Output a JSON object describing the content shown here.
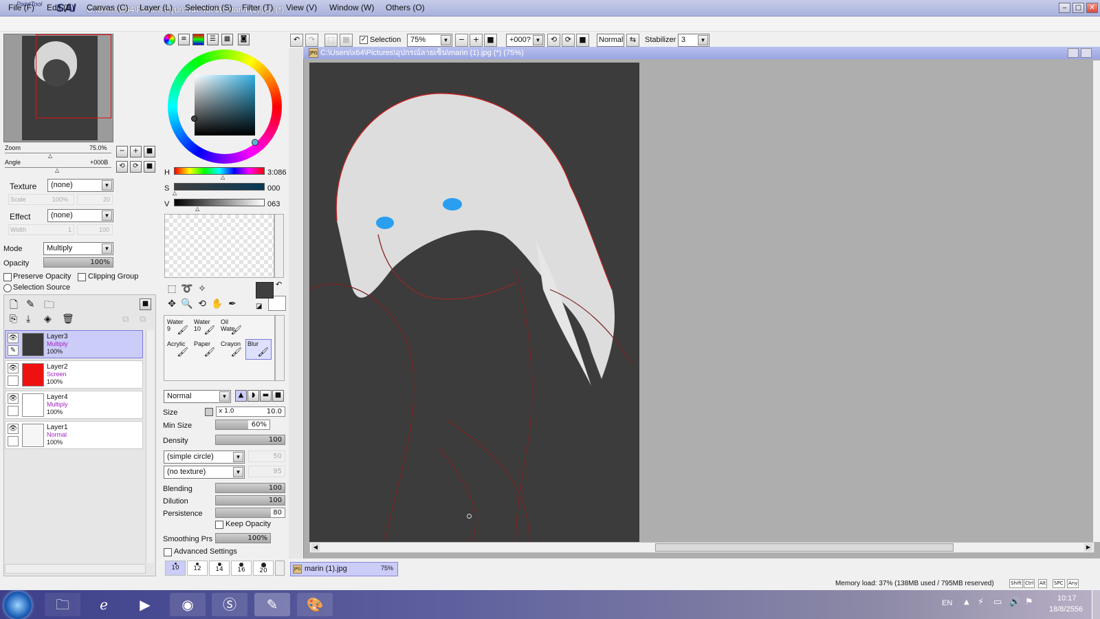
{
  "app": {
    "logo_small": "PaintTool",
    "logo_big": "SAI",
    "title": "C:\\Users\\x64\\Pictures\\อุปกรณ์ลายเซ็น\\marin (1).jpg (*)"
  },
  "menu": [
    "File (F)",
    "Edit (E)",
    "Canvas (C)",
    "Layer (L)",
    "Selection (S)",
    "Filter (T)",
    "View (V)",
    "Window (W)",
    "Others (O)"
  ],
  "toolbar": {
    "selection_label": "Selection",
    "selection_checked": true,
    "zoom": "75%",
    "angle": "+000?",
    "mode": "Normal",
    "stabilizer_label": "Stabilizer",
    "stabilizer": "3"
  },
  "navigator": {
    "zoom_label": "Zoom",
    "zoom_value": "75.0%",
    "angle_label": "Angle",
    "angle_value": "+000B"
  },
  "layer_props": {
    "texture_label": "Texture",
    "texture_value": "(none)",
    "scale_label": "Scale",
    "scale_value": "100%",
    "scale_num": "20",
    "effect_label": "Effect",
    "effect_value": "(none)",
    "width_label": "Width",
    "width_value": "1",
    "width_num": "100",
    "mode_label": "Mode",
    "mode_value": "Multiply",
    "opacity_label": "Opacity",
    "opacity_value": "100%",
    "preserve_opacity": "Preserve Opacity",
    "clipping_group": "Clipping Group",
    "selection_source": "Selection Source"
  },
  "layers": [
    {
      "name": "Layer3",
      "mode": "Multiply",
      "opacity": "100%",
      "selected": true,
      "thumb": "#3a3a3a"
    },
    {
      "name": "Layer2",
      "mode": "Screen",
      "opacity": "100%",
      "selected": false,
      "thumb": "#ee1111"
    },
    {
      "name": "Layer4",
      "mode": "Multiply",
      "opacity": "100%",
      "selected": false,
      "thumb": "#ffffff"
    },
    {
      "name": "Layer1",
      "mode": "Normal",
      "opacity": "100%",
      "selected": false,
      "thumb": "#f6f6f6"
    }
  ],
  "color": {
    "h_label": "H",
    "h_value": "3:086",
    "s_label": "S",
    "s_value": "000",
    "v_label": "V",
    "v_value": "063",
    "foreground": "#3f3f3f",
    "background": "#ffffff"
  },
  "brushes": [
    {
      "size": "9",
      "name": "Water"
    },
    {
      "size": "10",
      "name": "Water"
    },
    {
      "size": "",
      "name": "Oil Wate"
    },
    {
      "size": "",
      "name": ""
    },
    {
      "size": "",
      "name": "Acrylic"
    },
    {
      "size": "",
      "name": "Paper"
    },
    {
      "size": "",
      "name": "Crayon"
    },
    {
      "size": "",
      "name": "Blur"
    }
  ],
  "brush_settings": {
    "blend_mode": "Normal",
    "size_label": "Size",
    "size_mult": "x 1.0",
    "size_value": "10.0",
    "min_size_label": "Min Size",
    "min_size_value": "60%",
    "min_size_level": 0.6,
    "density_label": "Density",
    "density_value": "100",
    "shape": "(simple circle)",
    "shape_value": "50",
    "texture": "(no texture)",
    "texture_value": "95",
    "blending_label": "Blending",
    "blending_value": "100",
    "dilution_label": "Dilution",
    "dilution_value": "100",
    "persistence_label": "Persistence",
    "persistence_value": "80",
    "keep_opacity": "Keep Opacity",
    "smoothing_label": "Smoothing Prs",
    "smoothing_value": "100%",
    "advanced": "Advanced Settings",
    "preset_sizes": [
      "10",
      "12",
      "14",
      "16",
      "20"
    ]
  },
  "document": {
    "title": "C:\\Users\\x64\\Pictures\\อุปกรณ์ลายเซ็น\\marin (1).jpg (*) (75%)",
    "tab_name": "marin (1).jpg",
    "tab_zoom": "75%"
  },
  "status": {
    "memory": "Memory load: 37% (138MB used / 795MB reserved)",
    "keys": [
      "Shift",
      "Ctrl",
      "Alt",
      "SPC",
      "Any"
    ]
  },
  "taskbar": {
    "lang": "EN",
    "time": "10:17",
    "date": "18/8/2556",
    "apps": [
      "start",
      "explorer",
      "internet-explorer",
      "media-player",
      "chrome",
      "skype",
      "painttool-sai",
      "paint"
    ]
  }
}
